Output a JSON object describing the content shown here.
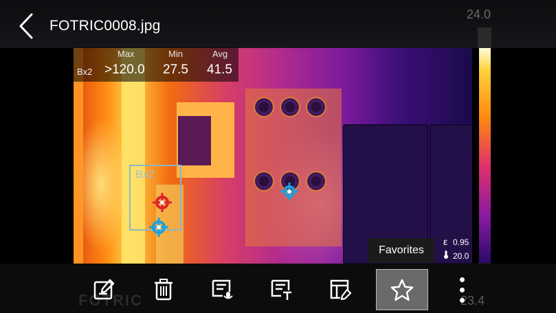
{
  "header": {
    "title": "FOTRIC0008.jpg",
    "ghost_temp_top": "24.0"
  },
  "measurement": {
    "col_max": "Max",
    "col_min": "Min",
    "col_avg": "Avg",
    "row_label": "Bx2",
    "max_value": ">120.0",
    "min_value": "27.5",
    "avg_value": "41.5"
  },
  "roi": {
    "label": "Bx2"
  },
  "params": {
    "emissivity": "0.95",
    "reflected_temp": "20.0",
    "emissivity_icon": "epsilon-icon",
    "temp_icon": "thermometer-icon"
  },
  "tooltip": {
    "label": "Favorites"
  },
  "palette": {
    "ghost_bottom": "23.4"
  },
  "toolbar": {
    "items": [
      {
        "icon": "edit-icon",
        "name": "edit"
      },
      {
        "icon": "delete-icon",
        "name": "delete"
      },
      {
        "icon": "voice-note-icon",
        "name": "voice-note"
      },
      {
        "icon": "text-note-icon",
        "name": "text-note"
      },
      {
        "icon": "report-icon",
        "name": "report"
      },
      {
        "icon": "star-icon",
        "name": "favorites",
        "active": true
      }
    ],
    "more_icon": "more-vertical-icon"
  },
  "colors": {
    "background": "#000000",
    "toolbar": "#0c0c0c",
    "active_tool": "#6a6a6a",
    "max_marker": "#e0222a",
    "min_marker": "#1fa0d8"
  }
}
